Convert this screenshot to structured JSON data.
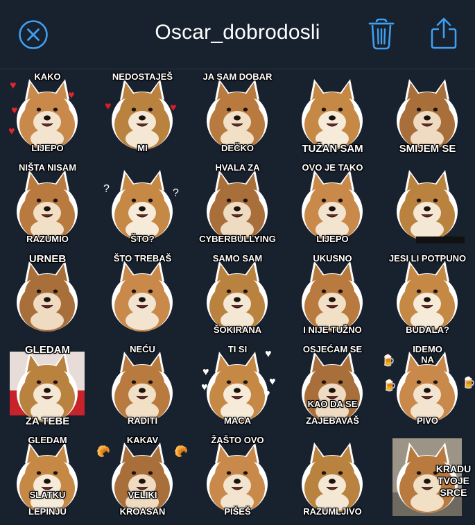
{
  "header": {
    "title": "Oscar_dobrodosli",
    "close_icon": "close-circle-icon",
    "trash_icon": "trash-icon",
    "share_icon": "share-icon",
    "accent": "#3f9ff0"
  },
  "stickers": [
    {
      "top": "KAKO",
      "bottom": "LIJEPO",
      "deco": "hearts"
    },
    {
      "top": "NEDOSTAJEŠ",
      "bottom": "MI",
      "deco": "hearts-broken"
    },
    {
      "top": "JA SAM DOBAR",
      "bottom": "DEČKO"
    },
    {
      "top": "",
      "bottom": "TUŽAN SAM",
      "big": true
    },
    {
      "top": "",
      "bottom": "SMIJEM SE",
      "big": true
    },
    {
      "top": "NIŠTA NISAM",
      "bottom": "RAZUMIO"
    },
    {
      "top": "",
      "bottom": "ŠTO?",
      "deco": "question"
    },
    {
      "top": "HVALA ZA",
      "bottom": "CYBERBULLYING"
    },
    {
      "top": "OVO JE TAKO",
      "bottom": "LIJEPO"
    },
    {
      "top": "",
      "bottom": "",
      "censored": true
    },
    {
      "top": "URNEB",
      "bottom": "",
      "big": true
    },
    {
      "top": "ŠTO TREBAŠ",
      "bottom": ""
    },
    {
      "top": "SAMO SAM",
      "bottom": "ŠOKIRANA"
    },
    {
      "top": "UKUSNO",
      "bottom": "I NIJE TUŽNO"
    },
    {
      "top": "JESI LI POTPUNO",
      "bottom": "BUDALA?"
    },
    {
      "top": "GLEDAM",
      "bottom": "ZA TEBE",
      "big": true,
      "photo": true
    },
    {
      "top": "NEĆU",
      "bottom": "RADITI"
    },
    {
      "top": "TI SI",
      "bottom": "MACA",
      "deco": "hearts-white"
    },
    {
      "top": "OSJEĆAM SE",
      "bottom": "ZAJEBAVAŠ",
      "mid": "KAO DA SE"
    },
    {
      "top": "IDEMO",
      "bottom": "PIVO",
      "top2": "NA",
      "deco": "beer"
    },
    {
      "top": "GLEDAM",
      "bottom": "LEPINJU",
      "mid": "SLATKU"
    },
    {
      "top": "KAKAV",
      "bottom": "KROASAN",
      "mid": "VELIKI",
      "deco": "croissant"
    },
    {
      "top": "ŽAŠTO OVO",
      "bottom": "PIŠEŠ"
    },
    {
      "top": "",
      "bottom": "RAZUMLJIVO"
    },
    {
      "top": "",
      "bottom": "",
      "side": "KRADU TVOJE SRCE",
      "photo2": true
    }
  ]
}
